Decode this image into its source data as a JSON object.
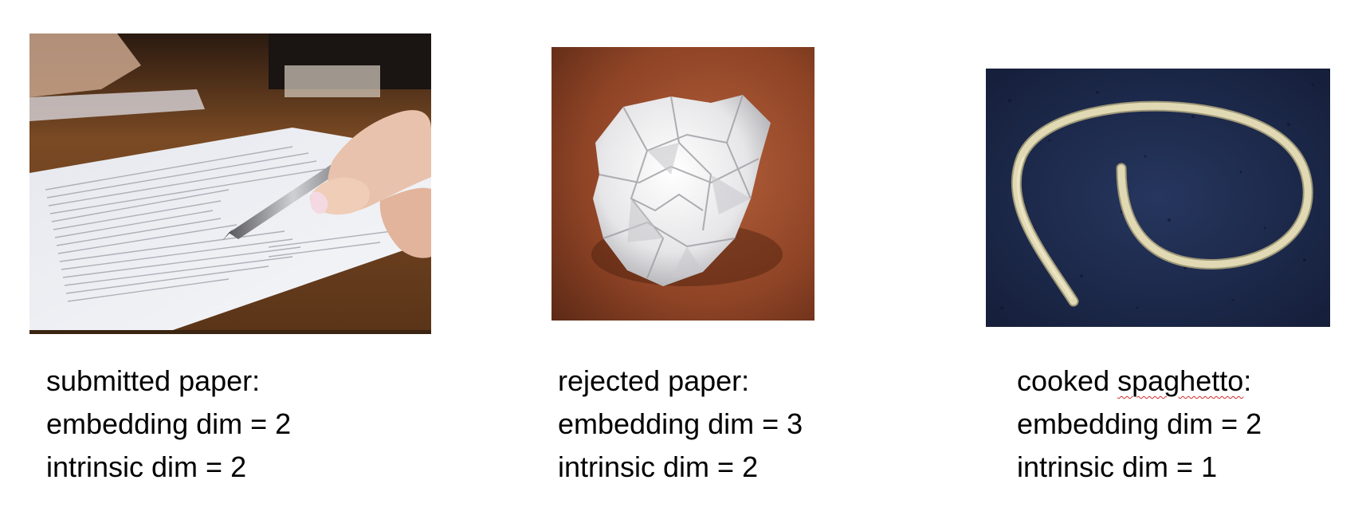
{
  "panels": [
    {
      "image": "submitted-paper-photo",
      "title": "submitted paper:",
      "embedding": "embedding dim = 2",
      "intrinsic": "intrinsic dim = 2"
    },
    {
      "image": "crumpled-paper-photo",
      "title": "rejected paper:",
      "embedding": "embedding dim = 3",
      "intrinsic": "intrinsic dim = 2"
    },
    {
      "image": "spaghetti-strand-photo",
      "title_word": "cooked",
      "title_misspelled": "spaghetto",
      "title_colon": ":",
      "embedding": "embedding dim = 2",
      "intrinsic": "intrinsic dim = 1"
    }
  ],
  "colors": {
    "spellcheck_underline": "#d42a2a",
    "crumpled_background": "#9a4a2a",
    "spaghetti_background": "#1c2a4e",
    "spaghetti_strand": "#d9d2ae",
    "desk_wood": "#5a3418"
  }
}
